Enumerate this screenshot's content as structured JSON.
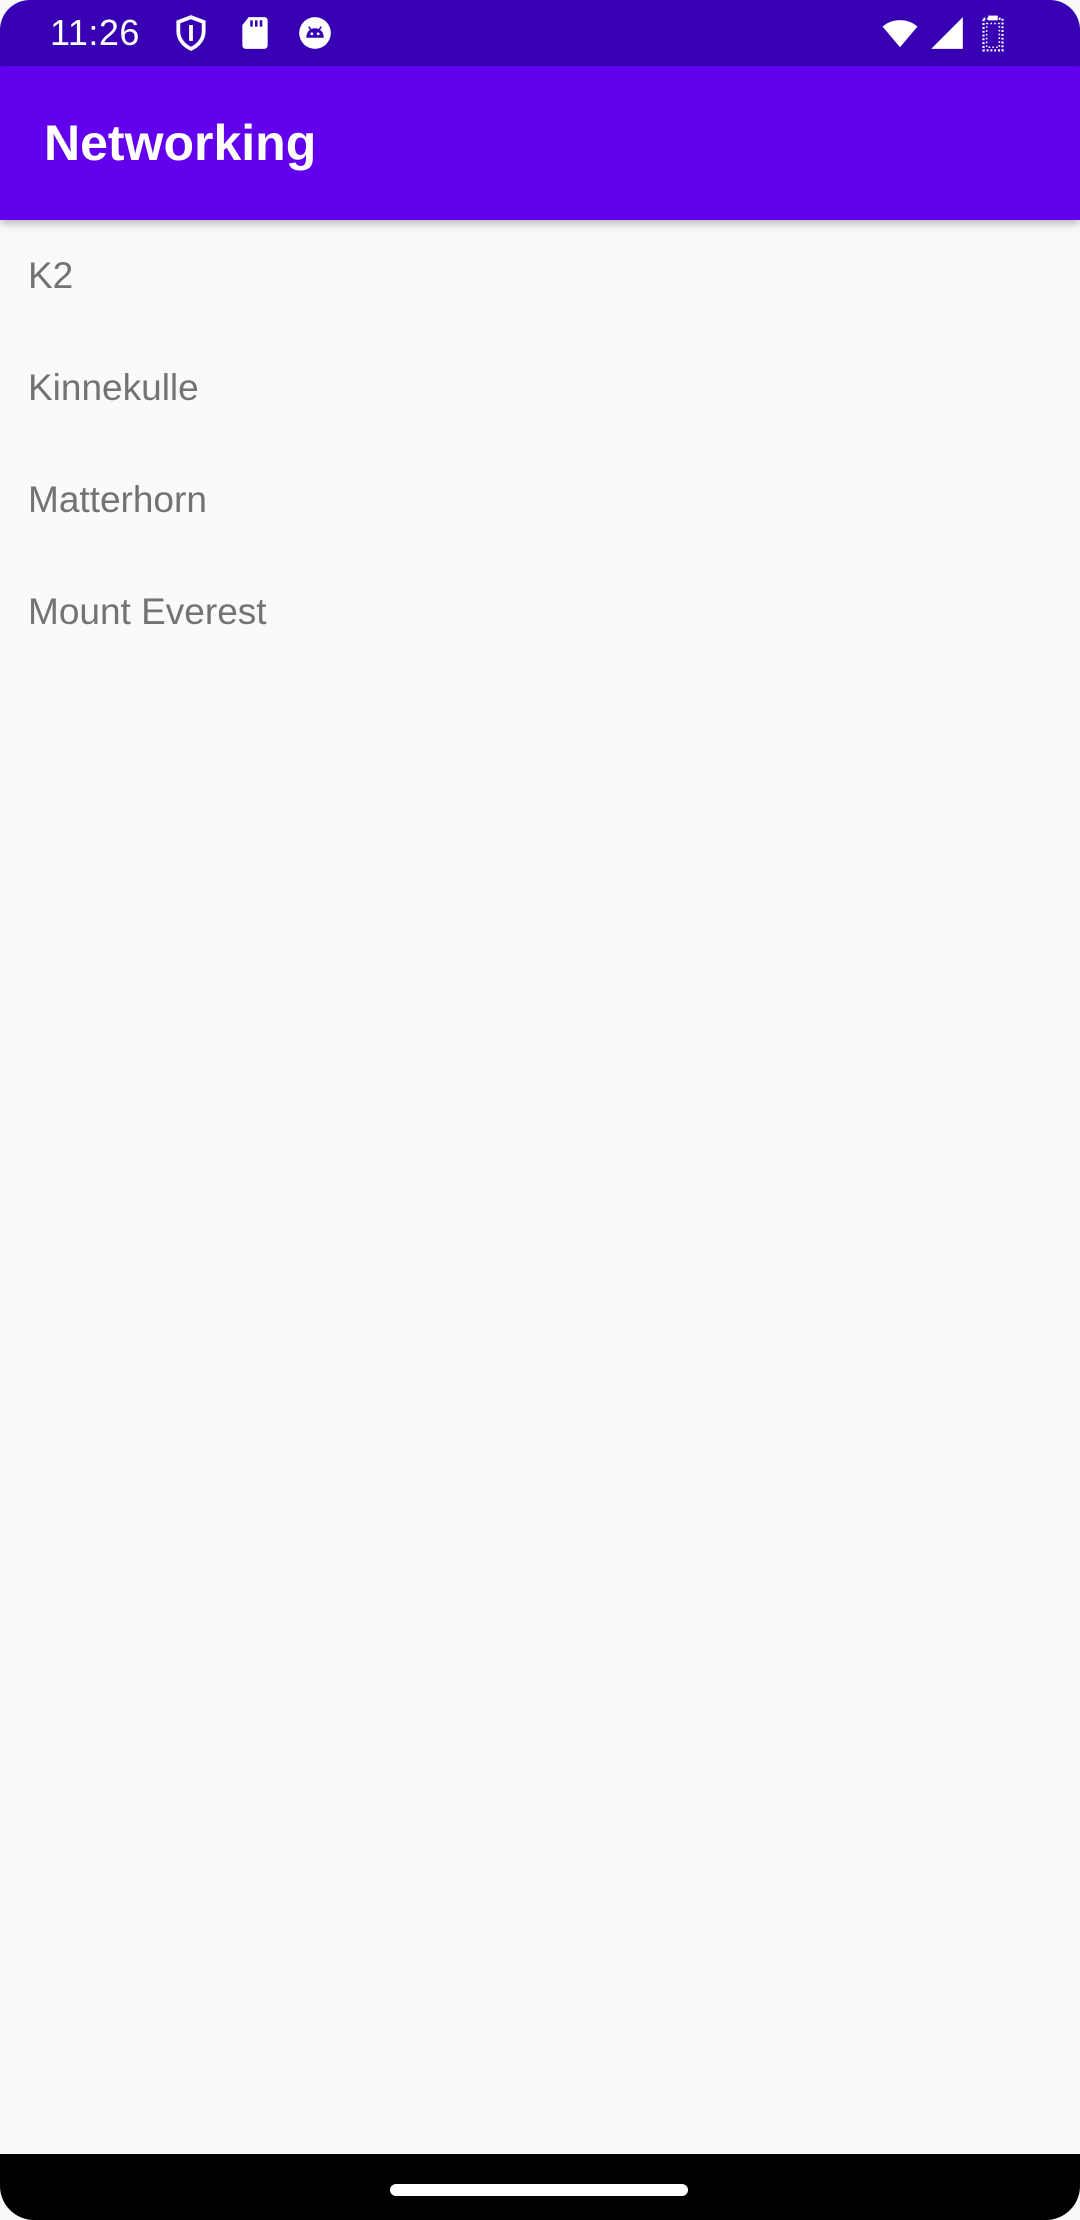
{
  "status_bar": {
    "time": "11:26",
    "left_icons": [
      "shield-icon",
      "sd-card-icon",
      "android-debug-icon"
    ],
    "right_icons": [
      "wifi-icon",
      "cellular-signal-icon",
      "battery-icon"
    ],
    "color": "#3700b3"
  },
  "app_bar": {
    "title": "Networking",
    "color": "#6200ee"
  },
  "list": {
    "items": [
      {
        "label": "K2"
      },
      {
        "label": "Kinnekulle"
      },
      {
        "label": "Matterhorn"
      },
      {
        "label": "Mount Everest"
      }
    ]
  },
  "nav_bar": {
    "handle": "home-gesture-handle"
  }
}
